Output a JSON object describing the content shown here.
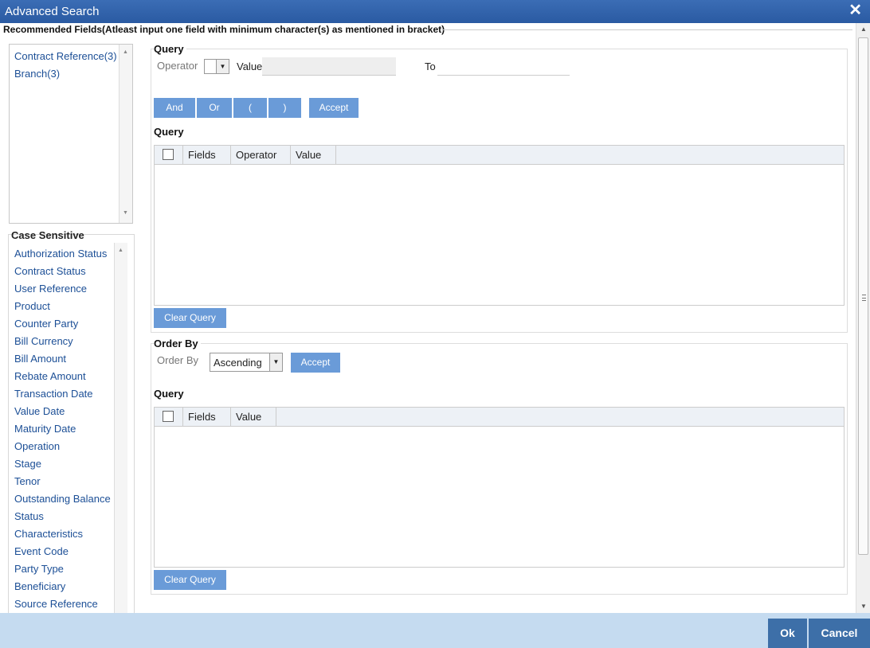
{
  "window": {
    "title": "Advanced Search",
    "close_symbol": "✕"
  },
  "recommended_heading": "Recommended Fields(Atleast input one field with minimum character(s) as mentioned in bracket)",
  "recommended_fields": [
    "Contract Reference(3)",
    "Branch(3)"
  ],
  "case_sensitive": {
    "label": "Case Sensitive",
    "fields": [
      "Authorization Status",
      "Contract Status",
      "User Reference",
      "Product",
      "Counter Party",
      "Bill Currency",
      "Bill Amount",
      "Rebate Amount",
      "Transaction Date",
      "Value Date",
      "Maturity Date",
      "Operation",
      "Stage",
      "Tenor",
      "Outstanding Balance",
      "Status",
      "Characteristics",
      "Event Code",
      "Party Type",
      "Beneficiary",
      "Source Reference"
    ]
  },
  "query": {
    "title": "Query",
    "operator_label": "Operator",
    "value_label": "Value",
    "to_label": "To",
    "operator_value": "",
    "value": "",
    "to_value": "",
    "buttons": {
      "and": "And",
      "or": "Or",
      "open_paren": "(",
      "close_paren": ")",
      "accept": "Accept"
    },
    "grid_title": "Query",
    "grid_columns": [
      "Fields",
      "Operator",
      "Value"
    ],
    "clear_label": "Clear Query"
  },
  "order_by": {
    "title": "Order By",
    "label": "Order By",
    "selected": "Ascending",
    "accept": "Accept",
    "grid_title": "Query",
    "grid_columns": [
      "Fields",
      "Value"
    ],
    "clear_label": "Clear Query"
  },
  "footer": {
    "ok": "Ok",
    "cancel": "Cancel"
  },
  "icons": {
    "close": "close-icon",
    "dropdown": "chevron-down-icon",
    "scroll_up": "arrow-up-icon",
    "scroll_down": "arrow-down-icon"
  },
  "colors": {
    "titlebar": "#2f62ab",
    "button": "#6a9bd8",
    "footer": "#c5dbf0",
    "footer_button": "#3d6fa8",
    "link": "#1c4f96"
  }
}
